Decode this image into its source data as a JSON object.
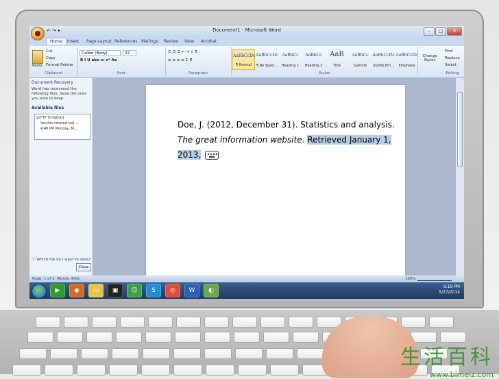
{
  "window": {
    "title": "Document1 - Microsoft Word",
    "office_button": "⬤",
    "qat": "↶ ↷ ▾",
    "controls": [
      "–",
      "□",
      "✕"
    ]
  },
  "tabs": [
    "Home",
    "Insert",
    "Page Layout",
    "References",
    "Mailings",
    "Review",
    "View",
    "Acrobat"
  ],
  "ribbon": {
    "clipboard": {
      "paste": "Paste",
      "cut": "Cut",
      "copy": "Copy",
      "format_painter": "Format Painter",
      "label": "Clipboard"
    },
    "font": {
      "family": "Calibri (Body)",
      "size": "22",
      "label": "Font",
      "buttons": "B  I  U  abe  x₂  x²  Aa"
    },
    "paragraph": {
      "label": "Paragraph",
      "buttons": "≡  ≡  ≡  ≡   ↕   ¶"
    },
    "styles": {
      "label": "Styles",
      "items": [
        {
          "sample": "AaBbCcDc",
          "name": "¶ Normal"
        },
        {
          "sample": "AaBbCcDc",
          "name": "¶ No Spaci..."
        },
        {
          "sample": "AaBbCc",
          "name": "Heading 1"
        },
        {
          "sample": "AaBbCc",
          "name": "Heading 2"
        },
        {
          "sample": "AaB",
          "name": "Title"
        },
        {
          "sample": "AaBbCc",
          "name": "Subtitle"
        },
        {
          "sample": "AaBbCcDc",
          "name": "Subtle Em..."
        },
        {
          "sample": "AaBbCcDc",
          "name": "Emphasis"
        }
      ],
      "change_styles": "Change Styles"
    },
    "editing": {
      "find": "Find",
      "replace": "Replace",
      "select": "Select",
      "label": "Editing"
    }
  },
  "recovery": {
    "title": "Document Recovery",
    "message": "Word has recovered the following files.  Save the ones you wish to keep.",
    "available": "Available files",
    "file": {
      "name": "FTP  [Original]",
      "line2": "Version created last ...",
      "line3": "4:48 PM Monday, M..."
    },
    "help": "Which file do I want to save?",
    "close": "Close"
  },
  "document": {
    "line1": "Doe, J. (2012, December 31). Statistics and analysis.",
    "line2_italic": "The great information website.",
    "line2_highlight": "Retrieved January 1,",
    "line3_highlight": "2013,"
  },
  "status": {
    "page": "Page: 1 of 1",
    "words": "Words: 4/16",
    "zoom": "100%"
  },
  "taskbar": {
    "time": "6:19 PM",
    "date": "5/27/2014"
  },
  "watermark": {
    "cn": "生活百科",
    "url": "www.bimeiz.com"
  }
}
